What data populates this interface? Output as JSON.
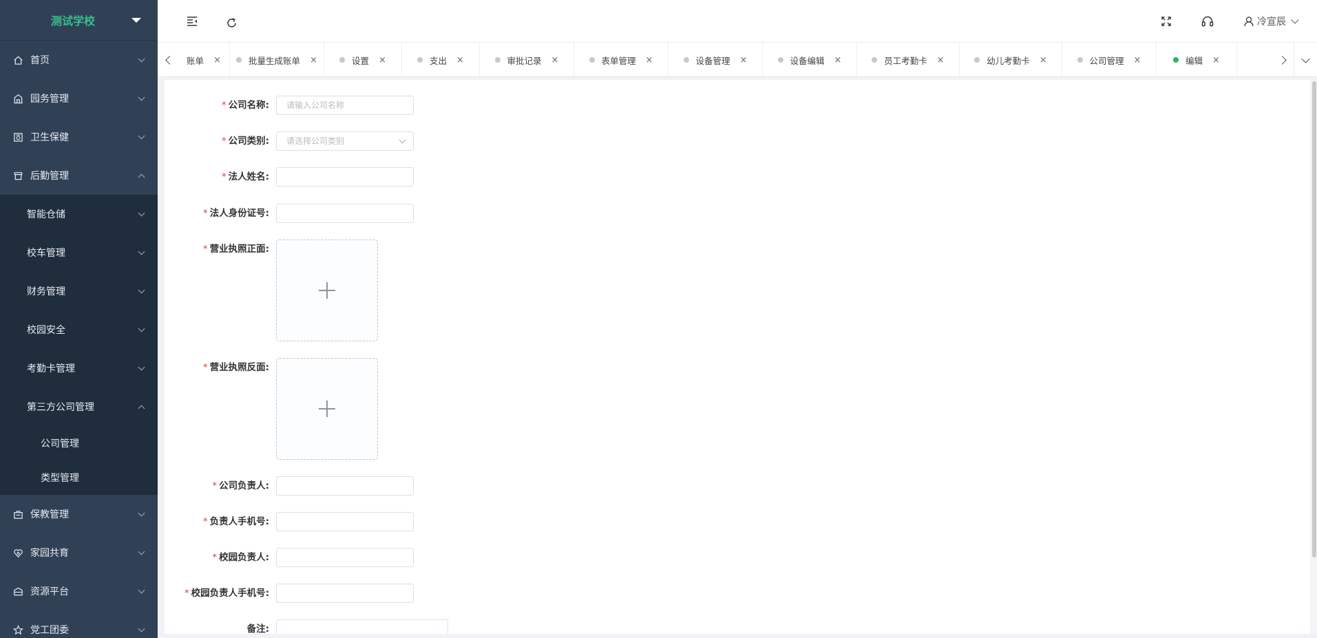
{
  "sidebar": {
    "school_name": "测试学校",
    "items": [
      {
        "label": "首页",
        "icon": "home-icon"
      },
      {
        "label": "园务管理",
        "icon": "building-icon"
      },
      {
        "label": "卫生保健",
        "icon": "health-icon"
      },
      {
        "label": "后勤管理",
        "icon": "logistics-icon",
        "expanded": true
      }
    ],
    "logistics_sub": [
      {
        "label": "智能仓储"
      },
      {
        "label": "校车管理"
      },
      {
        "label": "财务管理"
      },
      {
        "label": "校园安全"
      },
      {
        "label": "考勤卡管理"
      },
      {
        "label": "第三方公司管理",
        "expanded": true
      }
    ],
    "third_party_sub": [
      {
        "label": "公司管理"
      },
      {
        "label": "类型管理"
      }
    ],
    "items_after": [
      {
        "label": "保教管理",
        "icon": "education-icon"
      },
      {
        "label": "家园共育",
        "icon": "heart-icon"
      },
      {
        "label": "资源平台",
        "icon": "resource-icon"
      },
      {
        "label": "党工团委",
        "icon": "star-icon"
      }
    ]
  },
  "navbar": {
    "user_name": "冷宣辰"
  },
  "tabs": [
    {
      "label": "账单",
      "active": false,
      "partial": true
    },
    {
      "label": "批量生成账单",
      "active": false
    },
    {
      "label": "设置",
      "active": false
    },
    {
      "label": "支出",
      "active": false
    },
    {
      "label": "审批记录",
      "active": false
    },
    {
      "label": "表单管理",
      "active": false
    },
    {
      "label": "设备管理",
      "active": false
    },
    {
      "label": "设备编辑",
      "active": false
    },
    {
      "label": "员工考勤卡",
      "active": false
    },
    {
      "label": "幼儿考勤卡",
      "active": false
    },
    {
      "label": "公司管理",
      "active": false
    },
    {
      "label": "编辑",
      "active": true
    }
  ],
  "tab_close_glyph": "×",
  "form": {
    "company_name": {
      "label": "公司名称:",
      "placeholder": "请输入公司名称"
    },
    "company_type": {
      "label": "公司类别:",
      "placeholder": "请选择公司类别"
    },
    "legal_name": {
      "label": "法人姓名:"
    },
    "legal_id": {
      "label": "法人身份证号:"
    },
    "license_front": {
      "label": "营业执照正面:"
    },
    "license_back": {
      "label": "营业执照反面:"
    },
    "company_head": {
      "label": "公司负责人:"
    },
    "head_phone": {
      "label": "负责人手机号:"
    },
    "campus_head": {
      "label": "校园负责人:"
    },
    "campus_head_phone": {
      "label": "校园负责人手机号:"
    },
    "remark": {
      "label": "备注:"
    }
  },
  "required_mark": "*",
  "colors": {
    "sidebar_bg": "#304156",
    "submenu_bg": "#1f2d3d",
    "brand_green": "#36c08a",
    "active_dot": "#2fb06b",
    "required_red": "#e5423d"
  }
}
